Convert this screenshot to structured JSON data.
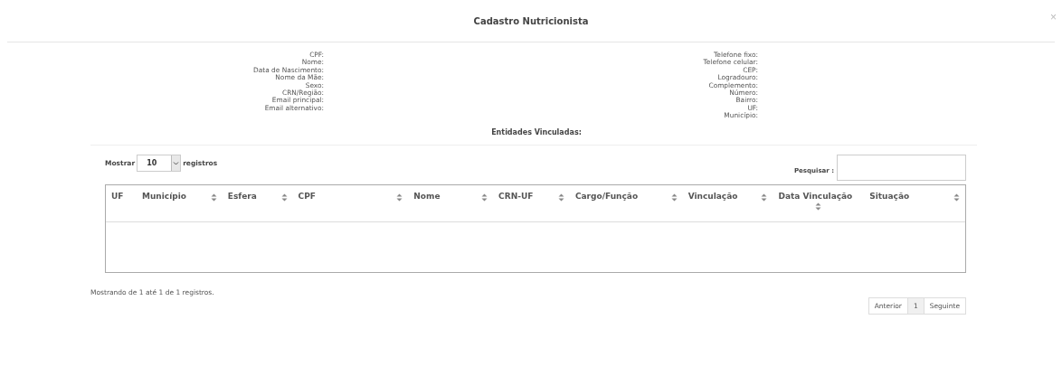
{
  "modal": {
    "title": "Cadastro Nutricionista",
    "close": "×"
  },
  "details_left": [
    "CPF:",
    "Nome:",
    "Data de Nascimento:",
    "Nome da Mãe:",
    "Sexo:",
    "CRN/Região:",
    "Email principal:",
    "Email alternativo:"
  ],
  "details_right": [
    "Telefone fixo:",
    "Telefone celular:",
    "CEP:",
    "Logradouro:",
    "Complemento:",
    "Número:",
    "Bairro:",
    "UF:",
    "Município:"
  ],
  "section_title": "Entidades Vinculadas:",
  "length_control": {
    "label_before": "Mostrar",
    "value": "10",
    "label_after": "registros"
  },
  "search": {
    "label": "Pesquisar :"
  },
  "table": {
    "columns": [
      {
        "label": "UF",
        "sortable": false
      },
      {
        "label": "Município",
        "sortable": true
      },
      {
        "label": "Esfera",
        "sortable": true
      },
      {
        "label": "CPF",
        "sortable": true
      },
      {
        "label": "Nome",
        "sortable": true
      },
      {
        "label": "CRN-UF",
        "sortable": true
      },
      {
        "label": "Cargo/Função",
        "sortable": true
      },
      {
        "label": "Vinculação",
        "sortable": true
      },
      {
        "label": "Data Vinculação",
        "sortable": true
      },
      {
        "label": "Situação",
        "sortable": true
      }
    ]
  },
  "info": "Mostrando de 1 até 1 de 1 registros.",
  "pagination": [
    {
      "label": "Anterior",
      "selected": false
    },
    {
      "label": "1",
      "selected": true
    },
    {
      "label": "Seguinte",
      "selected": false
    }
  ]
}
